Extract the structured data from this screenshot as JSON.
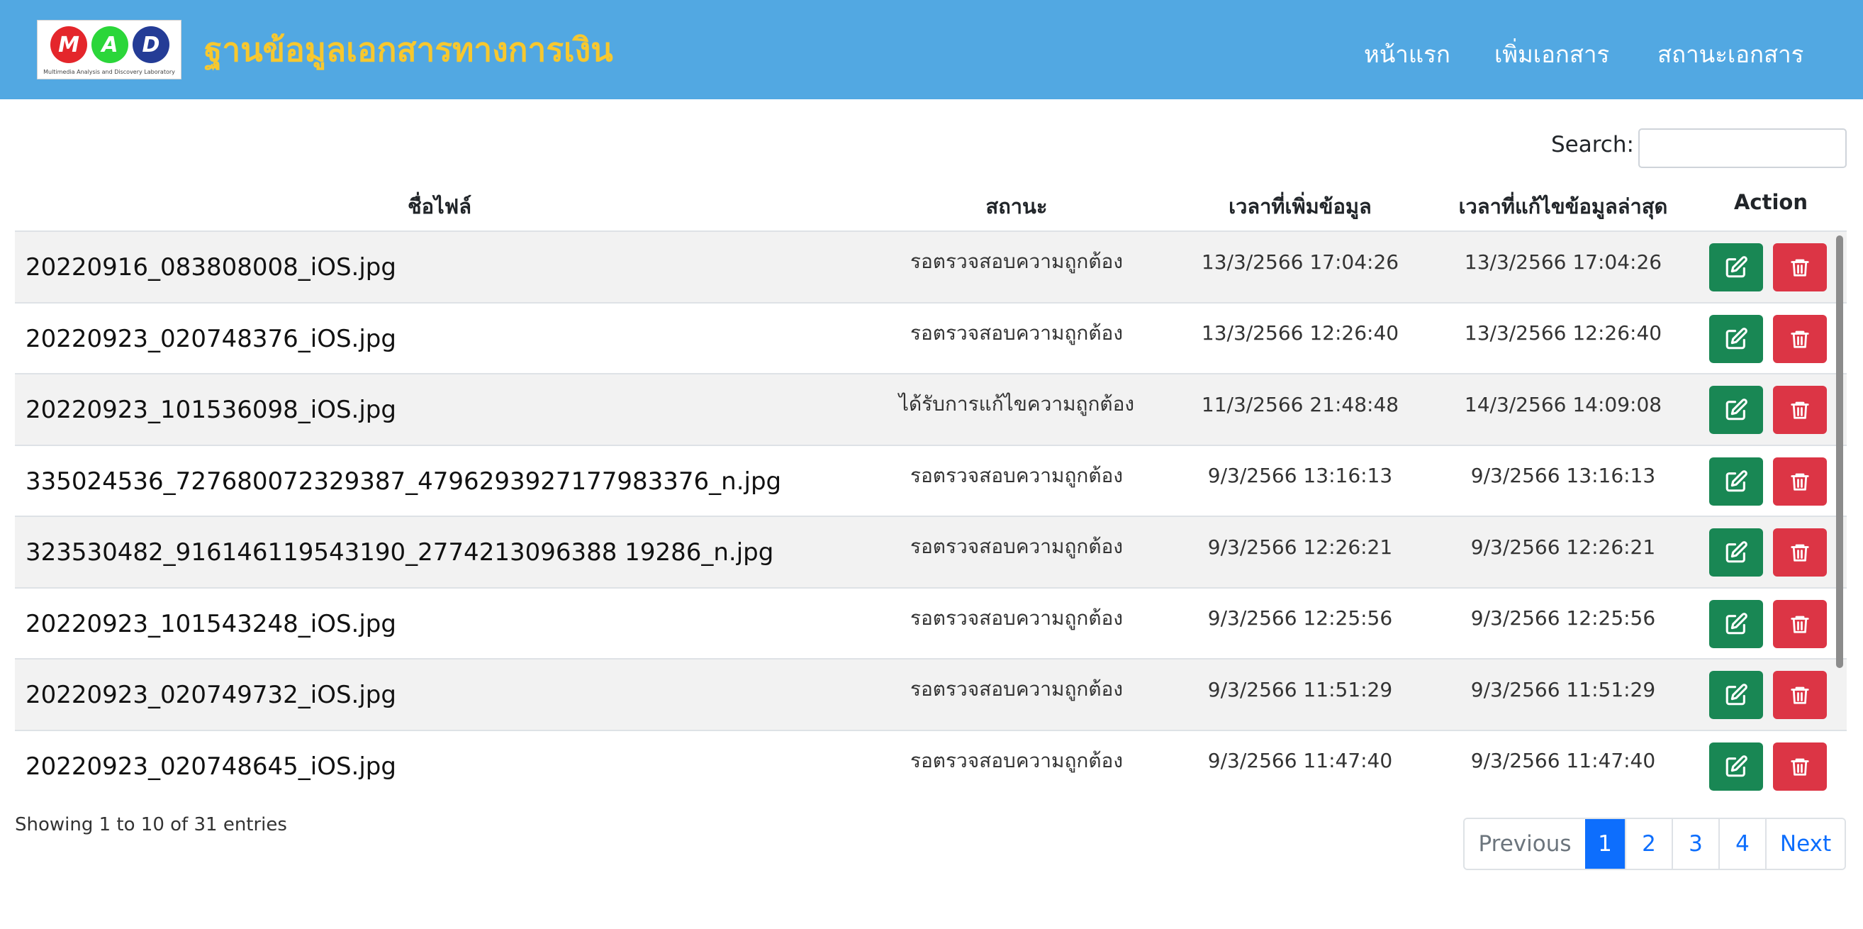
{
  "header": {
    "logo_letters": [
      "M",
      "A",
      "D"
    ],
    "logo_tagline": "Multimedia Analysis and Discovery Laboratory",
    "site_title": "ฐานข้อมูลเอกสารทางการเงิน",
    "nav": {
      "home": "หน้าแรก",
      "add_document": "เพิ่มเอกสาร",
      "document_status": "สถานะเอกสาร"
    },
    "colors": {
      "navbar": "#52a8e2",
      "title": "#f7c82f"
    }
  },
  "search": {
    "label": "Search:",
    "value": ""
  },
  "table": {
    "columns": {
      "file_name": "ชื่อไฟล์",
      "status": "สถานะ",
      "added_time": "เวลาที่เพิ่มข้อมูล",
      "updated_time": "เวลาที่แก้ไขข้อมูลล่าสุด",
      "action": "Action"
    },
    "rows": [
      {
        "file_name": "20220916_083808008_iOS.jpg",
        "status": "รอตรวจสอบความถูกต้อง",
        "added": "13/3/2566 17:04:26",
        "updated": "13/3/2566 17:04:26"
      },
      {
        "file_name": "20220923_020748376_iOS.jpg",
        "status": "รอตรวจสอบความถูกต้อง",
        "added": "13/3/2566 12:26:40",
        "updated": "13/3/2566 12:26:40"
      },
      {
        "file_name": "20220923_101536098_iOS.jpg",
        "status": "ได้รับการแก้ไขความถูกต้อง",
        "added": "11/3/2566 21:48:48",
        "updated": "14/3/2566 14:09:08"
      },
      {
        "file_name": "335024536_727680072329387_4796293927177983376_n.jpg",
        "status": "รอตรวจสอบความถูกต้อง",
        "added": "9/3/2566 13:16:13",
        "updated": "9/3/2566 13:16:13"
      },
      {
        "file_name": "323530482_916146119543190_2774213096388 19286_n.jpg",
        "status": "รอตรวจสอบความถูกต้อง",
        "added": "9/3/2566 12:26:21",
        "updated": "9/3/2566 12:26:21"
      },
      {
        "file_name": "20220923_101543248_iOS.jpg",
        "status": "รอตรวจสอบความถูกต้อง",
        "added": "9/3/2566 12:25:56",
        "updated": "9/3/2566 12:25:56"
      },
      {
        "file_name": "20220923_020749732_iOS.jpg",
        "status": "รอตรวจสอบความถูกต้อง",
        "added": "9/3/2566 11:51:29",
        "updated": "9/3/2566 11:51:29"
      },
      {
        "file_name": "20220923_020748645_iOS.jpg",
        "status": "รอตรวจสอบความถูกต้อง",
        "added": "9/3/2566 11:47:40",
        "updated": "9/3/2566 11:47:40"
      }
    ],
    "action_icons": {
      "edit": "edit-icon",
      "delete": "trash-icon"
    },
    "colors": {
      "edit": "#198754",
      "delete": "#dc3545",
      "striped_row": "#f2f2f2"
    }
  },
  "footer": {
    "info": "Showing 1 to 10 of 31 entries",
    "pagination": {
      "previous": "Previous",
      "pages": [
        "1",
        "2",
        "3",
        "4"
      ],
      "current": "1",
      "next": "Next"
    }
  }
}
